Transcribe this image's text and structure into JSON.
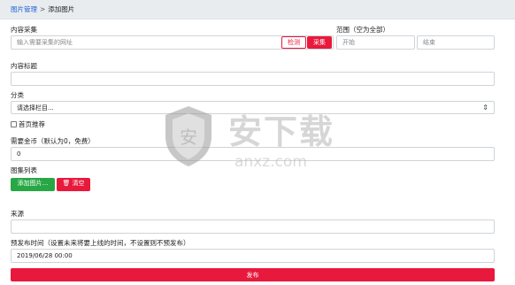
{
  "breadcrumb": {
    "parent": "图片管理",
    "separator": ">",
    "current": "添加图片"
  },
  "collect": {
    "label": "内容采集",
    "url_placeholder": "输入需要采集的网址",
    "detect_button": "检测",
    "collect_button": "采集",
    "range_label": "范围（空为全部）",
    "start_placeholder": "开始",
    "end_placeholder": "结束"
  },
  "title_field": {
    "label": "内容标题",
    "value": ""
  },
  "category": {
    "label": "分类",
    "selected": "请选择栏目..."
  },
  "homepage_recommend": {
    "label": "首页推荐",
    "checked": false
  },
  "coins": {
    "label": "需要金币（默认为0，免费）",
    "value": "0"
  },
  "gallery": {
    "label": "图集列表",
    "add_button": "添加图片...",
    "clear_button": "清空"
  },
  "source": {
    "label": "来源",
    "value": ""
  },
  "publish_time": {
    "label": "预发布时间（设置未来将要上线的时间，不设置则不预发布）",
    "value": "2019/06/28 00:00"
  },
  "submit_button": "发布",
  "watermark": {
    "brand": "安下载",
    "domain": "anxz.com"
  },
  "colors": {
    "accent_red": "#e8193c",
    "green": "#28a745",
    "link_blue": "#1e63d6"
  }
}
